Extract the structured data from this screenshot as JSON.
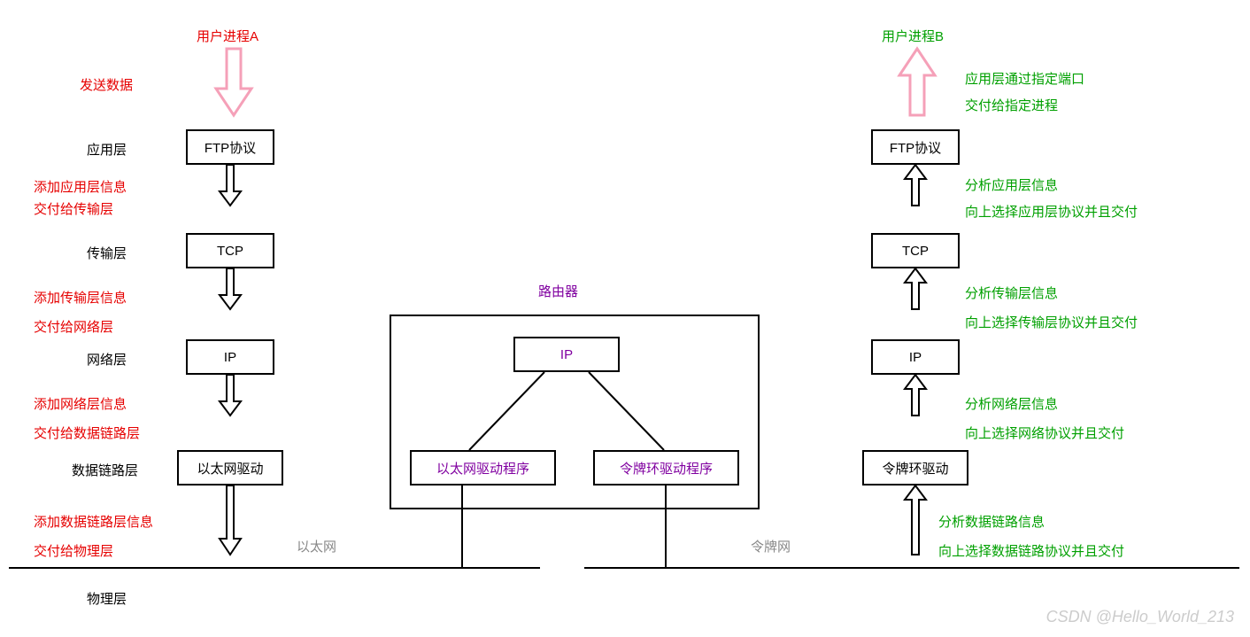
{
  "left": {
    "title": "用户进程A",
    "side_label": "发送数据",
    "layers": {
      "app": "应用层",
      "transport": "传输层",
      "network": "网络层",
      "datalink": "数据链路层",
      "physical": "物理层"
    },
    "boxes": {
      "ftp": "FTP协议",
      "tcp": "TCP",
      "ip": "IP",
      "eth": "以太网驱动"
    },
    "annotations": {
      "a1_line1": "添加应用层信息",
      "a1_line2": "交付给传输层",
      "a2_line1": "添加传输层信息",
      "a2_line2": "交付给网络层",
      "a3_line1": "添加网络层信息",
      "a3_line2": "交付给数据链路层",
      "a4_line1": "添加数据链路层信息",
      "a4_line2": "交付给物理层"
    }
  },
  "right": {
    "title": "用户进程B",
    "boxes": {
      "ftp": "FTP协议",
      "tcp": "TCP",
      "ip": "IP",
      "token": "令牌环驱动"
    },
    "annotations": {
      "a1_line1": "应用层通过指定端口",
      "a1_line2": "交付给指定进程",
      "a2_line1": "分析应用层信息",
      "a2_line2": "向上选择应用层协议并且交付",
      "a3_line1": "分析传输层信息",
      "a3_line2": "向上选择传输层协议并且交付",
      "a4_line1": "分析网络层信息",
      "a4_line2": "向上选择网络协议并且交付",
      "a5_line1": "分析数据链路信息",
      "a5_line2": "向上选择数据链路协议并且交付"
    }
  },
  "router": {
    "title": "路由器",
    "ip": "IP",
    "eth": "以太网驱动程序",
    "token": "令牌环驱动程序"
  },
  "networks": {
    "ethernet": "以太网",
    "token_ring": "令牌网"
  },
  "watermark": "CSDN @Hello_World_213"
}
